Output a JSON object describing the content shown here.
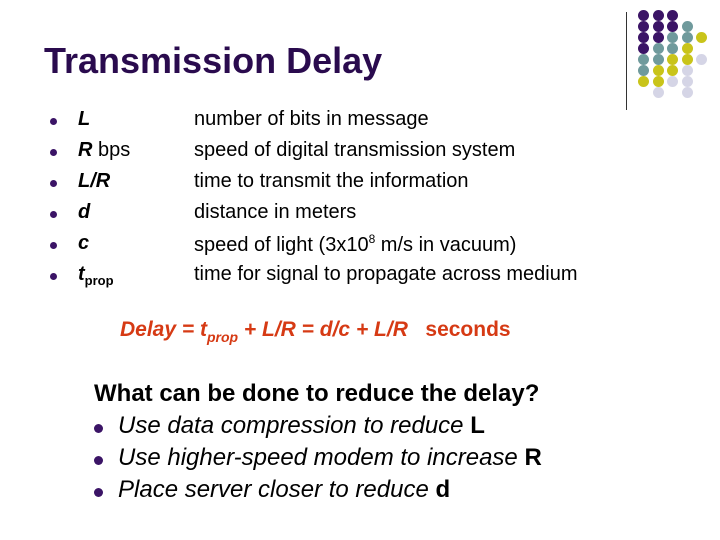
{
  "slide": {
    "title": "Transmission Delay",
    "definitions": [
      {
        "term": "L",
        "term_suffix": "",
        "term_sub": "",
        "description": "number of bits in message"
      },
      {
        "term": "R",
        "term_suffix": " bps",
        "term_sub": "",
        "description": "speed of digital transmission system"
      },
      {
        "term": "L/R",
        "term_suffix": "",
        "term_sub": "",
        "description": "time to transmit the information"
      },
      {
        "term": "d",
        "term_suffix": "",
        "term_sub": "",
        "description": "distance in meters"
      },
      {
        "term": "c",
        "term_suffix": "",
        "term_sub": "",
        "description_pre": "speed of light (3x10",
        "description_sup": "8",
        "description_post": " m/s in vacuum)"
      },
      {
        "term": "t",
        "term_suffix": "",
        "term_sub": "prop",
        "description": "time for signal to propagate across medium"
      }
    ],
    "formula": {
      "lhs": "Delay = t",
      "sub": "prop",
      "rhs": " + L/R = d/c + L/R",
      "unit": "seconds"
    },
    "question": "What can be done to reduce the delay?",
    "tips": [
      {
        "text": "Use data compression to reduce ",
        "variable": "L"
      },
      {
        "text": "Use higher-speed modem to increase ",
        "variable": "R"
      },
      {
        "text": "Place server closer to reduce ",
        "variable": "d"
      }
    ]
  },
  "colors": {
    "title": "#2a0b4e",
    "bullet": "#3b1466",
    "formula": "#d63a14",
    "dot_purple": "#3b1466",
    "dot_teal": "#6f9a9c",
    "dot_yellow": "#c9c41a",
    "dot_lavender": "#d5d5e6"
  },
  "decoration": {
    "dot_grid": [
      [
        "purple",
        "purple",
        "purple",
        "",
        ""
      ],
      [
        "purple",
        "purple",
        "purple",
        "teal",
        ""
      ],
      [
        "purple",
        "purple",
        "teal",
        "teal",
        "yellow"
      ],
      [
        "purple",
        "teal",
        "teal",
        "yellow",
        ""
      ],
      [
        "teal",
        "teal",
        "yellow",
        "yellow",
        "lavender"
      ],
      [
        "teal",
        "yellow",
        "yellow",
        "lavender",
        ""
      ],
      [
        "yellow",
        "yellow",
        "lavender",
        "lavender",
        ""
      ],
      [
        "",
        "lavender",
        "",
        "lavender",
        ""
      ]
    ]
  }
}
